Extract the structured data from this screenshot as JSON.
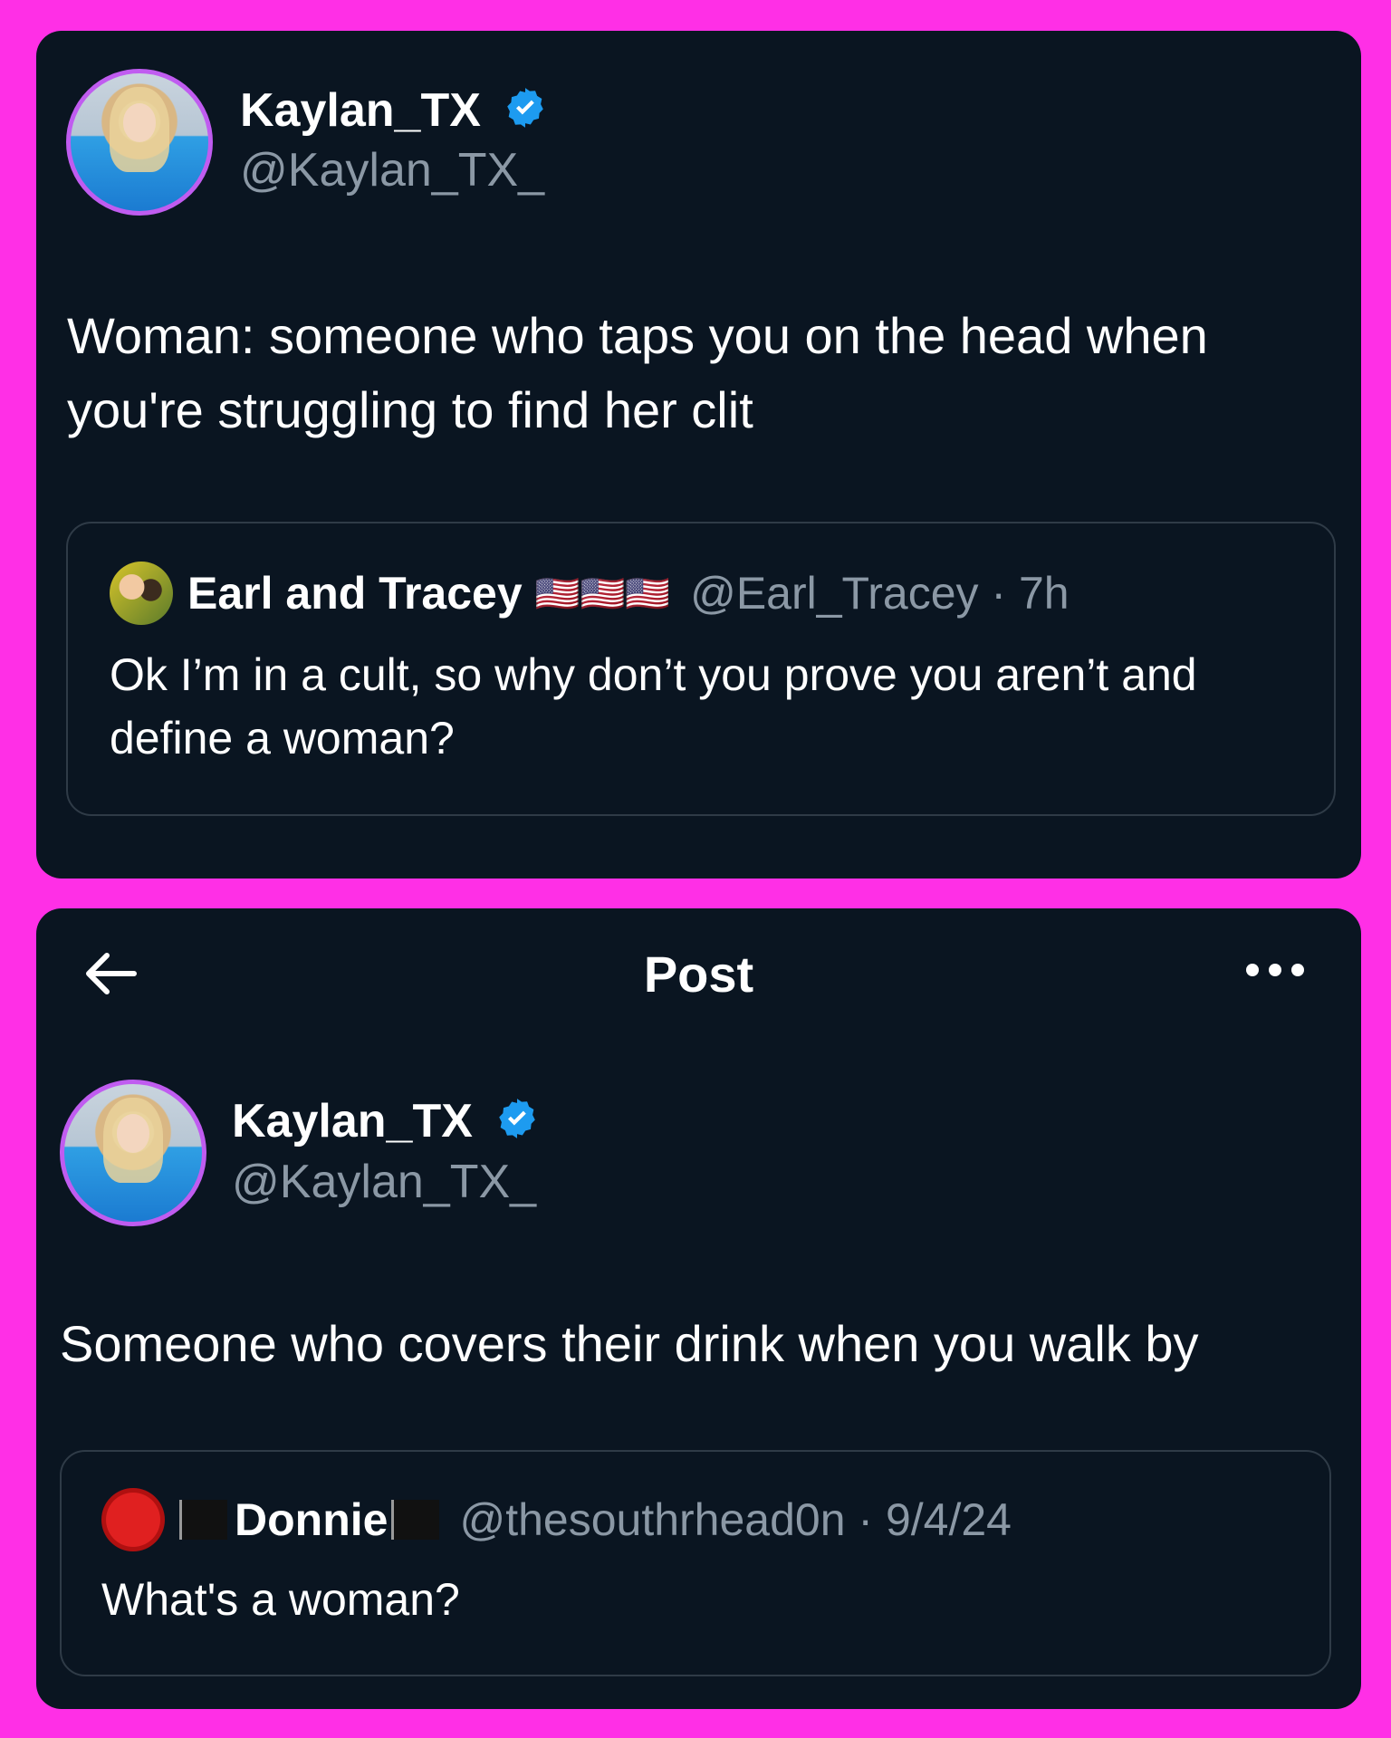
{
  "colors": {
    "background": "#ff2fe6",
    "card": "#0a1521",
    "verified": "#1d9bf0",
    "muted": "#8b98a5"
  },
  "post1": {
    "author_name": "Kaylan_TX",
    "author_handle": "@Kaylan_TX_",
    "text": "Woman: someone who taps you on the head when you're struggling to find her clit",
    "quote": {
      "name": "Earl and Tracey",
      "flags": "🇺🇸🇺🇸🇺🇸",
      "meta": "@Earl_Tracey · 7h",
      "text": "Ok I’m in a cult, so why don’t you prove you aren’t and define a woman?"
    }
  },
  "post2": {
    "nav_title": "Post",
    "author_name": "Kaylan_TX",
    "author_handle": "@Kaylan_TX_",
    "text": "Someone who covers their drink when you walk by",
    "quote": {
      "name": "Donnie",
      "meta": "@thesouthrhead0n · 9/4/24",
      "text": "What's a woman?"
    }
  }
}
